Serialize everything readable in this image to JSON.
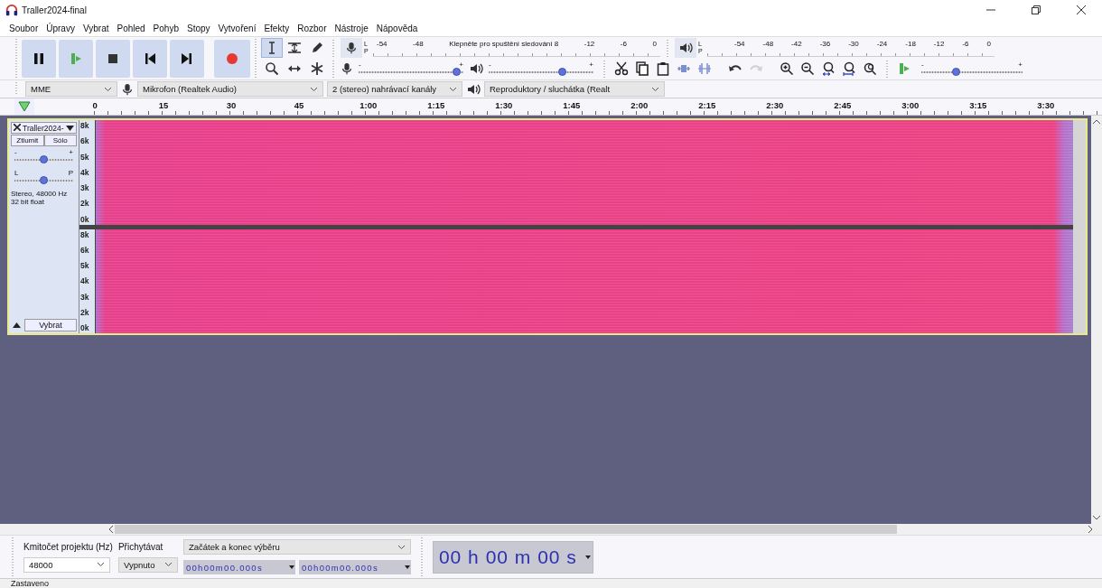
{
  "window": {
    "title": "Traller2024-final"
  },
  "menu": [
    "Soubor",
    "Úpravy",
    "Vybrat",
    "Pohled",
    "Pohyb",
    "Stopy",
    "Vytvoření",
    "Efekty",
    "Rozbor",
    "Nástroje",
    "Nápověda"
  ],
  "transport": [
    {
      "kind": "pause"
    },
    {
      "kind": "play"
    },
    {
      "kind": "stop"
    },
    {
      "kind": "skip-start"
    },
    {
      "kind": "skip-end"
    },
    {
      "kind": "record"
    }
  ],
  "tools": [
    {
      "kind": "select",
      "selected": true
    },
    {
      "kind": "envelope",
      "selected": false
    },
    {
      "kind": "draw",
      "selected": false
    },
    {
      "kind": "zoom",
      "selected": false
    },
    {
      "kind": "timeshift",
      "selected": false
    },
    {
      "kind": "multi",
      "selected": false
    }
  ],
  "recording_meter": {
    "channels": [
      "L",
      "P"
    ],
    "ticks": [
      "-54",
      "-48"
    ],
    "hint": "Klepněte pro spuštění sledování 8",
    "ticks_after": [
      "-12",
      "-6",
      "0"
    ]
  },
  "playback_meter": {
    "channels": [
      "L",
      "P"
    ],
    "ticks": [
      "-54",
      "-48",
      "-42",
      "-36",
      "-30",
      "-24",
      "-18",
      "-12",
      "-6",
      "0"
    ]
  },
  "mixer": {
    "recording_volume": {
      "min_label": "-",
      "max_label": "+",
      "level": 0.97
    },
    "playback_volume": {
      "min_label": "-",
      "max_label": "+",
      "level": 0.72
    }
  },
  "edit_tools": [
    {
      "kind": "cut",
      "disabled": false
    },
    {
      "kind": "copy",
      "disabled": false
    },
    {
      "kind": "paste",
      "disabled": false
    },
    {
      "kind": "trim",
      "disabled": false
    },
    {
      "kind": "silence",
      "disabled": false
    },
    {
      "kind": "undo",
      "disabled": false
    },
    {
      "kind": "redo",
      "disabled": true
    },
    {
      "kind": "zoom-in",
      "disabled": false
    },
    {
      "kind": "zoom-out",
      "disabled": false
    },
    {
      "kind": "fit-selection",
      "disabled": false
    },
    {
      "kind": "fit-project",
      "disabled": false
    },
    {
      "kind": "zoom-toggle",
      "disabled": false
    }
  ],
  "play_at_speed": {
    "min_label": "-",
    "max_label": "+",
    "level": 0.33
  },
  "devices": {
    "host": "MME",
    "recording_device": "Mikrofon (Realtek Audio)",
    "channels": "2 (stereo) nahrávací kanály",
    "playback_device": "Reproduktory / sluchátka (Realt"
  },
  "timeline": {
    "ticks": [
      "0",
      "15",
      "30",
      "45",
      "1:00",
      "1:15",
      "1:30",
      "1:45",
      "2:00",
      "2:15",
      "2:30",
      "2:45",
      "3:00",
      "3:15",
      "3:30"
    ]
  },
  "track": {
    "name": "Traller2024-",
    "mute": "Ztlumit",
    "solo": "Sólo",
    "gain": {
      "min_label": "-",
      "max_label": "+",
      "level": 0.5
    },
    "pan": {
      "min_label": "L",
      "max_label": "P",
      "level": 0.5
    },
    "info": [
      "Stereo, 48000 Hz",
      "32 bit float"
    ],
    "select": "Vybrat",
    "channels": [
      {
        "scale": [
          "8k",
          "6k",
          "5k",
          "4k",
          "3k",
          "2k",
          "0k"
        ]
      },
      {
        "scale": [
          "8k",
          "6k",
          "5k",
          "4k",
          "3k",
          "2k",
          "0k"
        ]
      }
    ]
  },
  "selection_bar": {
    "rate_label": "Kmitočet projektu (Hz)",
    "rate": "48000",
    "snap_label": "Přichytávat",
    "snap": "Vypnuto",
    "mode": "Začátek a konec výběru",
    "start": "00h00m00.000s",
    "end": "00h00m00.000s"
  },
  "time": "00 h 00 m 00 s",
  "status_bar": "Zastaveno"
}
